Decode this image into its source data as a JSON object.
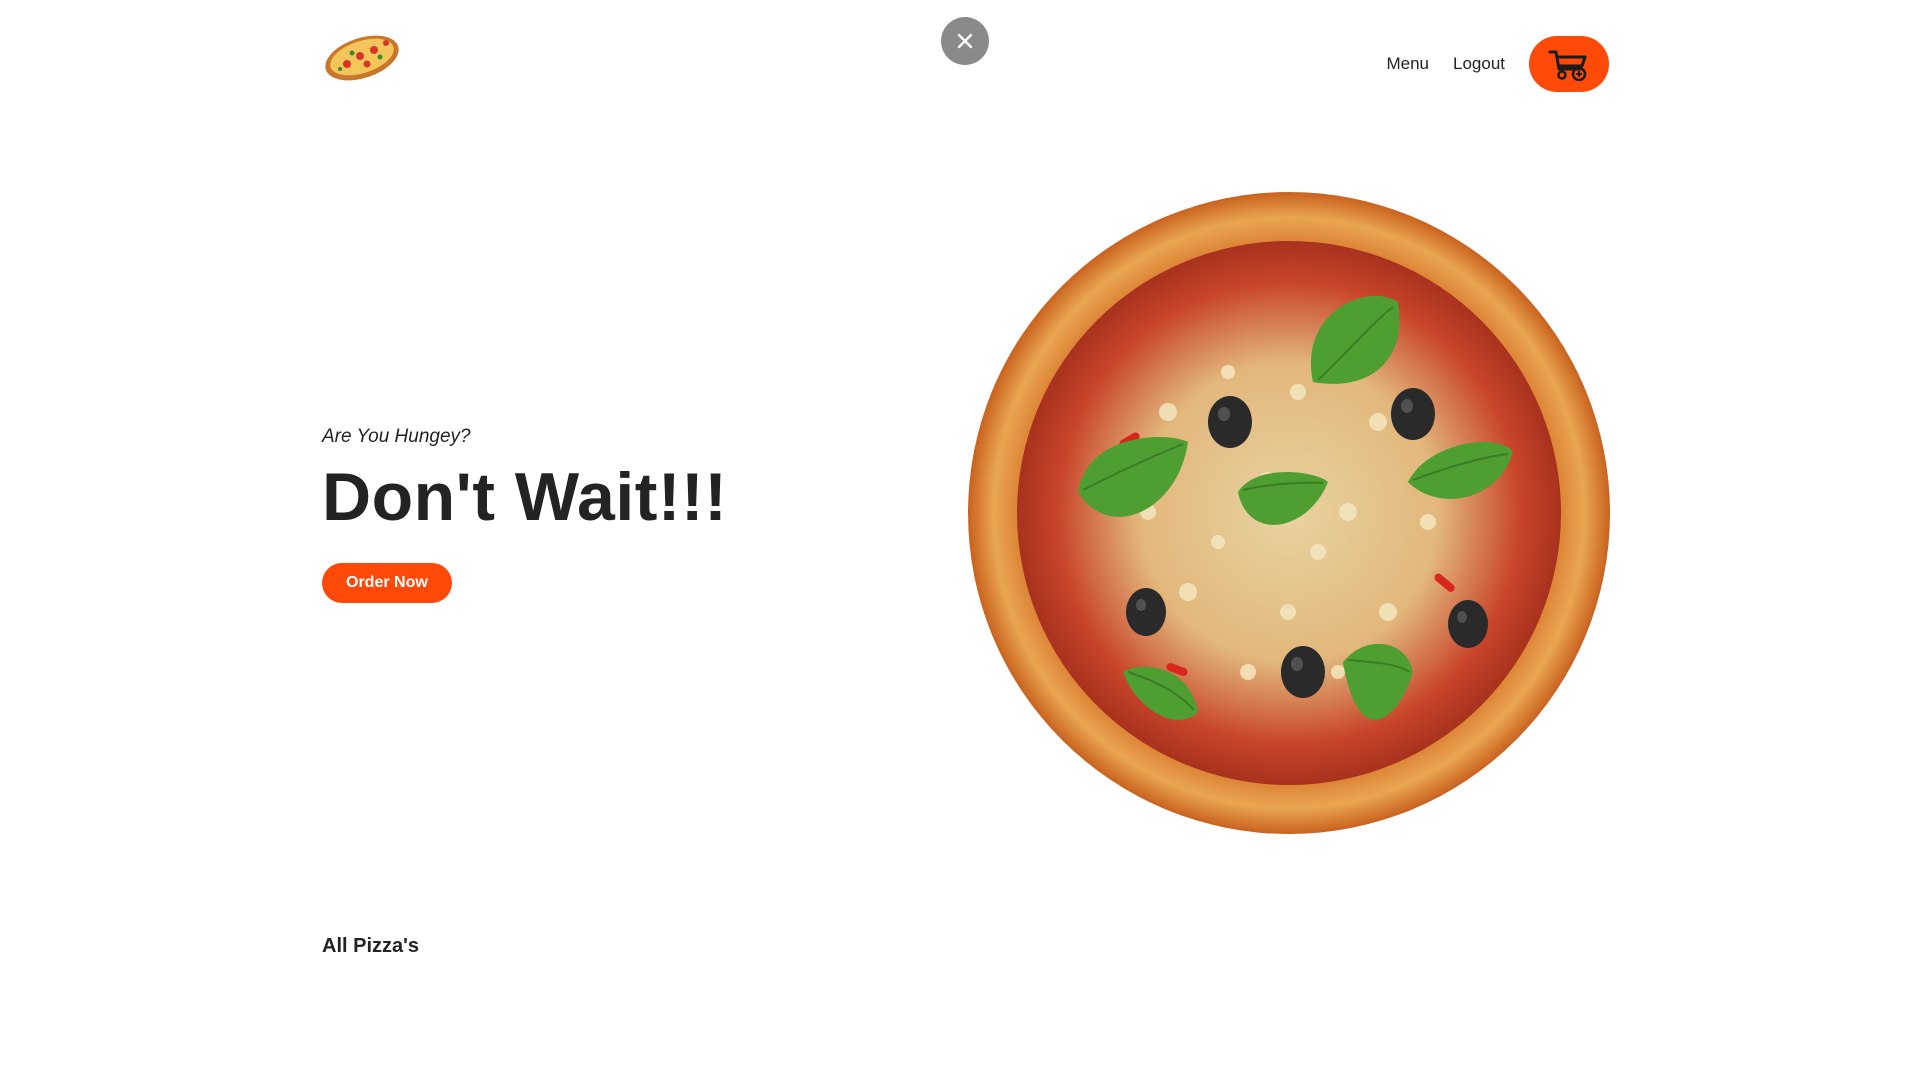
{
  "header": {
    "logo_icon": "pizza-logo-icon",
    "nav": [
      {
        "label": "Menu"
      },
      {
        "label": "Logout"
      }
    ],
    "cart_icon": "cart-icon"
  },
  "overlay": {
    "close_icon": "close-icon"
  },
  "hero": {
    "tagline": "Are You Hungey?",
    "headline": "Don't Wait!!!",
    "order_button": "Order Now",
    "image_icon": "pizza-image"
  },
  "section": {
    "title": "All Pizza's"
  },
  "colors": {
    "accent": "#fe4a09",
    "text": "#232323",
    "close_bg": "#8a8a8a"
  }
}
